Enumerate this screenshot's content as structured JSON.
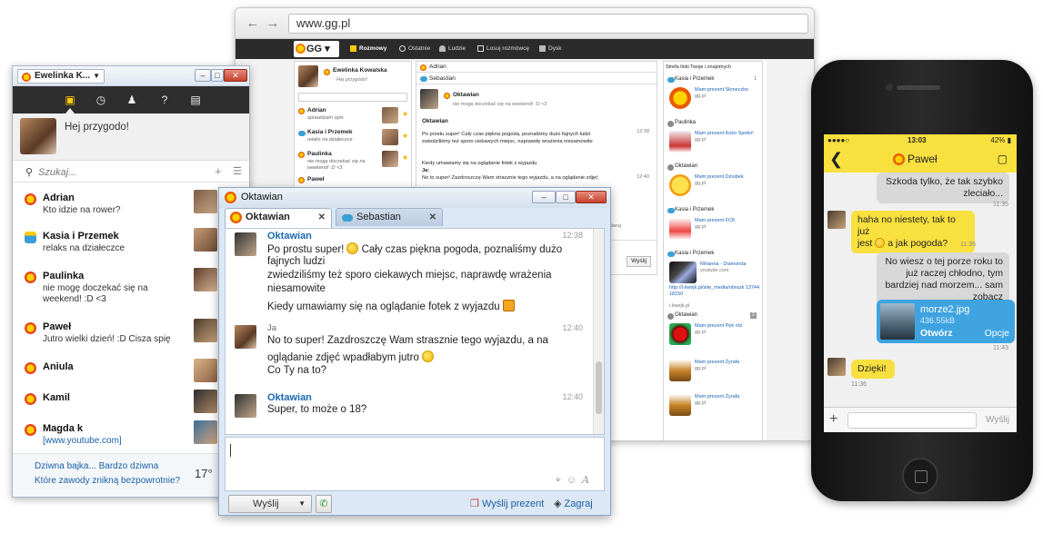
{
  "browser": {
    "url": "www.gg.pl",
    "logo": "GG",
    "tabs": [
      "Rozmowy",
      "Ostatnie",
      "Ludzie",
      "Losuj rozmówcę",
      "Dysk"
    ],
    "profile_name": "Ewelinka Kowalska",
    "profile_status": "Hej przygodo!",
    "contacts": [
      {
        "name": "Adrian",
        "status": "sprawdzam opis"
      },
      {
        "name": "Kasia i Przemek",
        "status": "relaks na działeczce"
      },
      {
        "name": "Paulinka",
        "status": "nie mogę doczekać się na weekend! :D <3"
      },
      {
        "name": "Paweł",
        "status": ""
      }
    ],
    "chat_tabs": [
      "Adrian",
      "Sebastian"
    ],
    "chat_header": {
      "name": "Oktawian",
      "status": "nie mogę doczekać się na weekend! :D <3"
    },
    "chat_lines": {
      "sender1": "Oktawian",
      "line1": "Po prostu super! Cały czas piękna pogoda, poznaliśmy dużo fajnych ludzi",
      "line2": "zwiedziliśmy też sporo ciekawych miejsc, naprawdę wrażenia niesamowite",
      "line3": "Kiedy umawiamy się na oglądanie fotek z wyjazdu",
      "sender2": "Ja:",
      "line4": "No to super! Zazdroszczę Wam strasznie tego wyjazdu, a na oglądanie zdjęć",
      "time1": "12:38",
      "time2": "12:40"
    },
    "send_label": "Wyślij",
    "podaruj": "Podaruj",
    "feed_title": "Strefa",
    "feed_subtitle": "linki Twoje i znajomych",
    "feed": [
      {
        "who": "Kasia i Przemek",
        "text": "Mam prezent Słoneczko",
        "src": "gg.pl",
        "count": "1"
      },
      {
        "who": "Paulinka",
        "text": "Mam prezent Koko Spoko!",
        "src": "gg.pl"
      },
      {
        "who": "Oktawian",
        "text": "Mam prezent Dziubek",
        "src": "gg.pl"
      },
      {
        "who": "Kasia i Przemek",
        "text": "Mam prezent FCK",
        "src": "gg.pl"
      },
      {
        "who": "Kasia i Przemek",
        "text": "Rihanna - Diamonda",
        "src": "youtube.com"
      },
      {
        "who": "",
        "text": "http://i.kwejk.pl/site_media/obrazk 1374418150",
        "src": "i.kwejk.pl"
      },
      {
        "who": "Oktawian",
        "text": "Mam prezent Pęk róż",
        "src": "gg.pl",
        "count": "2"
      },
      {
        "who": "",
        "text": "Mam prezent Żyrafa",
        "src": "gg.pl"
      },
      {
        "who": "",
        "text": "Mam prezent Żyrafa",
        "src": "gg.pl"
      }
    ]
  },
  "leftwin": {
    "title": "Ewelinka K...",
    "status": "Hej przygodo!",
    "search_placeholder": "Szukaj...",
    "contacts": [
      {
        "name": "Adrian",
        "status": "Kto idzie na rower?"
      },
      {
        "name": "Kasia i Przemek",
        "status": "relaks na działeczce"
      },
      {
        "name": "Paulinka",
        "status": "nie mogę doczekać się na weekend! :D <3"
      },
      {
        "name": "Paweł",
        "status": "Jutro wielki dzień! :D Cisza spię"
      },
      {
        "name": "Aniula",
        "status": ""
      },
      {
        "name": "Kamil",
        "status": ""
      },
      {
        "name": "Magda k",
        "status": "[www.youtube.com]"
      }
    ],
    "news": [
      "Dziwna bajka... Bardzo dziwna",
      "Które zawody znikną bezpowrotnie?"
    ],
    "temperature": "17°"
  },
  "chat": {
    "title": "Oktawian",
    "tabs": [
      "Oktawian",
      "Sebastian"
    ],
    "messages": [
      {
        "who": "Oktawian",
        "time": "12:38",
        "lines": [
          "Po prostu super!",
          " Cały czas piękna pogoda, poznaliśmy dużo",
          "fajnych ludzi",
          "zwiedziliśmy też sporo ciekawych miejsc, naprawdę wrażenia",
          "niesamowite",
          "Kiedy umawiamy się na oglądanie fotek z wyjazdu"
        ]
      },
      {
        "who": "Ja",
        "time": "12:40",
        "lines": [
          "No to super! Zazdroszczę Wam strasznie tego wyjazdu, a na",
          "oglądanie zdjęć wpadłabym jutro",
          "Co Ty na to?"
        ]
      },
      {
        "who": "Oktawian",
        "time": "12:40",
        "lines": [
          "Super, to może o 18?"
        ]
      }
    ],
    "send_label": "Wyślij",
    "gift_label": "Wyślij prezent",
    "play_label": "Zagraj"
  },
  "phone": {
    "time": "13:03",
    "battery": "42%",
    "contact": "Paweł",
    "messages": [
      {
        "dir": "out",
        "text": [
          "Szkoda tylko, że tak szybko",
          "zleciało..."
        ],
        "time": "11:35"
      },
      {
        "dir": "in",
        "text": [
          "haha no niestety, tak to już",
          "jest",
          " a jak pogoda?"
        ],
        "time": "11:36"
      },
      {
        "dir": "out",
        "text": [
          "No wiesz o tej porze roku to",
          "już raczej chłodno, tym",
          "bardziej nad morzem... sam",
          "zobacz"
        ],
        "time": ""
      },
      {
        "dir": "in",
        "text": [
          "Dzięki!"
        ],
        "time": "11:36"
      }
    ],
    "file": {
      "name": "morze2.jpg",
      "size": "436.55kB",
      "open": "Otwórz",
      "options": "Opcje",
      "time": "11:43"
    },
    "send_label": "Wyślij"
  }
}
